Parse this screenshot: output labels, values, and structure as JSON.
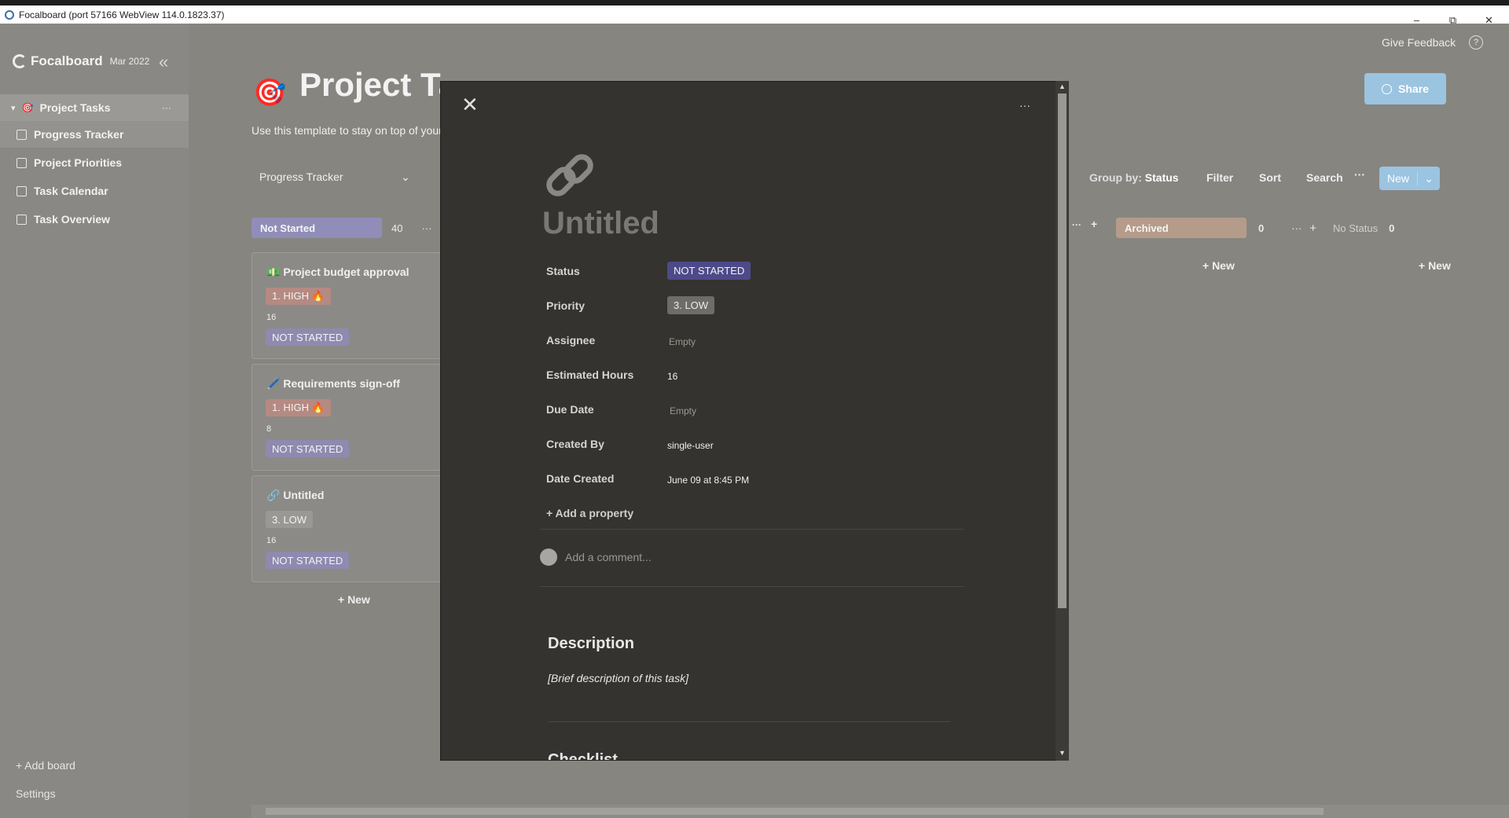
{
  "window": {
    "title": "Focalboard (port 57166 WebView 114.0.1823.37)",
    "minimize": "–",
    "maximize": "⧉",
    "close": "✕"
  },
  "sidebar": {
    "logo": "Focalboard",
    "version": "Mar 2022",
    "collapse": "«",
    "board": {
      "arrow": "▾",
      "icon": "🎯",
      "label": "Project Tasks",
      "more": "···"
    },
    "views": [
      {
        "label": "Progress Tracker"
      },
      {
        "label": "Project Priorities"
      },
      {
        "label": "Task Calendar"
      },
      {
        "label": "Task Overview"
      }
    ],
    "add_board": "+ Add board",
    "settings": "Settings"
  },
  "main": {
    "icon": "🎯",
    "title": "Project Tasks",
    "description": "Use this template to stay on top of your tasks.",
    "view_select": "Progress Tracker",
    "view_chevron": "⌄",
    "give_feedback": "Give Feedback",
    "help_icon": "?",
    "share": "Share",
    "toolbar": {
      "group_by_label": "Group by:",
      "group_by_value": "Status",
      "filter": "Filter",
      "sort": "Sort",
      "search": "Search",
      "more": "···",
      "new": "New",
      "new_caret": "⌄"
    },
    "columns": [
      {
        "name": "Not Started",
        "count": "40",
        "color": "#908db8"
      },
      {
        "name": "Archived",
        "count": "0",
        "color": "#b59b8a"
      },
      {
        "name": "No Status",
        "count": "0"
      }
    ],
    "column_more": "···",
    "column_add": "+",
    "cards": [
      {
        "icon": "💵",
        "title": "Project budget approval",
        "priority": "1. HIGH 🔥",
        "hours": "16",
        "status": "NOT STARTED"
      },
      {
        "icon": "🖊️",
        "title": "Requirements sign-off",
        "priority": "1. HIGH 🔥",
        "hours": "8",
        "status": "NOT STARTED"
      },
      {
        "icon": "🔗",
        "title": "Untitled",
        "priority": "3. LOW",
        "hours": "16",
        "status": "NOT STARTED"
      }
    ],
    "add_new": "+ New"
  },
  "modal": {
    "close": "✕",
    "more": "···",
    "title": "Untitled",
    "properties": [
      {
        "label": "Status",
        "value": "NOT STARTED"
      },
      {
        "label": "Priority",
        "value": "3. LOW"
      },
      {
        "label": "Assignee",
        "value": "Empty"
      },
      {
        "label": "Estimated Hours",
        "value": "16"
      },
      {
        "label": "Due Date",
        "value": "Empty"
      },
      {
        "label": "Created By",
        "value": "single-user"
      },
      {
        "label": "Date Created",
        "value": "June 09 at 8:45 PM"
      }
    ],
    "add_property": "+ Add a property",
    "comment_placeholder": "Add a comment...",
    "description_heading": "Description",
    "description_text": "[Brief description of this task]",
    "checklist_heading": "Checklist"
  },
  "colors": {
    "high": "#b58a82",
    "low": "#9a9894",
    "status": "#8e8ab0",
    "accent": "#9bc4e0"
  }
}
